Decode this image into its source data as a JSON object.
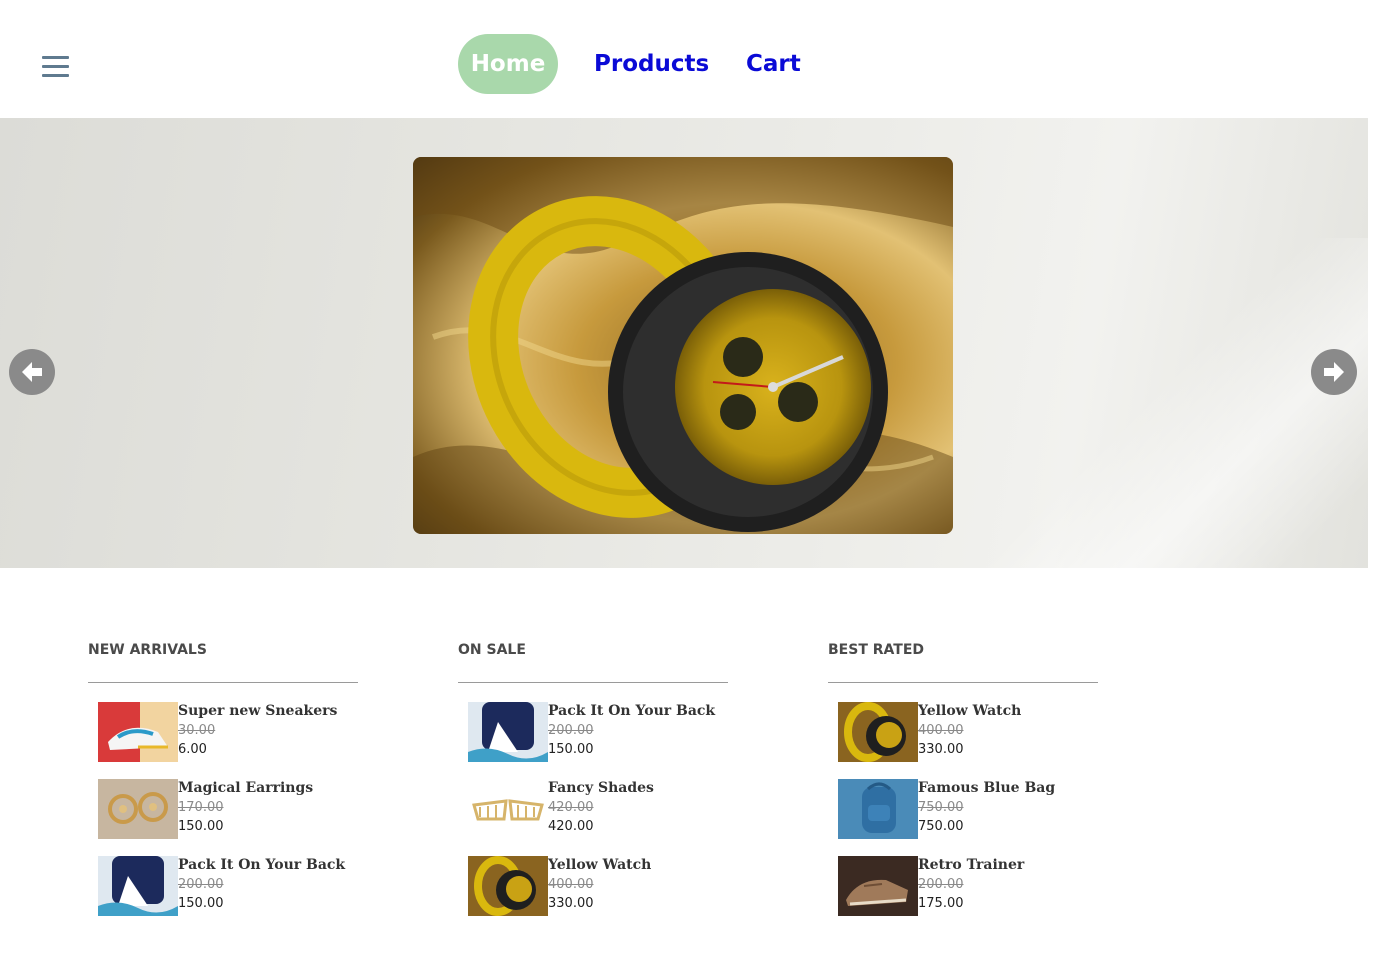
{
  "nav": {
    "menu_icon": "hamburger-menu-icon",
    "links": [
      {
        "label": "Home",
        "active": true
      },
      {
        "label": "Products",
        "active": false
      },
      {
        "label": "Cart",
        "active": false
      }
    ]
  },
  "hero": {
    "prev_icon": "arrow-left-circle-icon",
    "next_icon": "arrow-right-circle-icon"
  },
  "columns": [
    {
      "title": "NEW ARRIVALS",
      "items": [
        {
          "name": "Super new Sneakers",
          "old_price": "30.00",
          "price": "6.00"
        },
        {
          "name": "Magical Earrings",
          "old_price": "170.00",
          "price": "150.00"
        },
        {
          "name": "Pack It On Your Back",
          "old_price": "200.00",
          "price": "150.00"
        }
      ]
    },
    {
      "title": "ON SALE",
      "items": [
        {
          "name": "Pack It On Your Back",
          "old_price": "200.00",
          "price": "150.00"
        },
        {
          "name": "Fancy Shades",
          "old_price": "420.00",
          "price": "420.00"
        },
        {
          "name": "Yellow Watch",
          "old_price": "400.00",
          "price": "330.00"
        }
      ]
    },
    {
      "title": "BEST RATED",
      "items": [
        {
          "name": "Yellow Watch",
          "old_price": "400.00",
          "price": "330.00"
        },
        {
          "name": "Famous Blue Bag",
          "old_price": "750.00",
          "price": "750.00"
        },
        {
          "name": "Retro Trainer",
          "old_price": "200.00",
          "price": "175.00"
        }
      ]
    }
  ],
  "colors": {
    "nav_link": "#0a0ad6",
    "nav_active_bg": "#a9d8ab",
    "arrow_bg": "#8a8a8a"
  }
}
